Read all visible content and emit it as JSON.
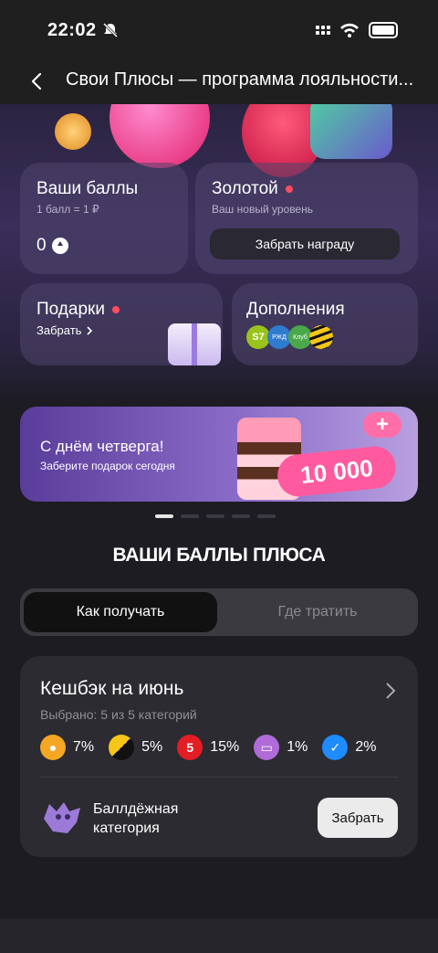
{
  "status_bar": {
    "time": "22:02"
  },
  "header": {
    "title": "Свои Плюсы — программа лояльности..."
  },
  "cards": {
    "points": {
      "title": "Ваши баллы",
      "subtitle": "1 балл = 1 ₽",
      "value": "0"
    },
    "level": {
      "title": "Золотой",
      "subtitle": "Ваш новый уровень",
      "button": "Забрать награду"
    },
    "gifts": {
      "title": "Подарки",
      "action": "Забрать"
    },
    "extras": {
      "title": "Дополнения",
      "partners": [
        "S7",
        "РЖД",
        "Клуб",
        "Билайн"
      ]
    }
  },
  "banner": {
    "title": "С днём четверга!",
    "subtitle": "Заберите подарок сегодня",
    "amount": "10 000"
  },
  "carousel": {
    "pages": 5,
    "active": 0
  },
  "section_title": "ВАШИ БАЛЛЫ ПЛЮСА",
  "tabs": [
    {
      "label": "Как получать",
      "active": true
    },
    {
      "label": "Где тратить",
      "active": false
    }
  ],
  "cashback": {
    "title": "Кешбэк на июнь",
    "subtitle": "Выбрано: 5 из 5 категорий",
    "categories": [
      {
        "icon": "apple-icon",
        "pct": "7%",
        "color": "#f5a623"
      },
      {
        "icon": "taxi-icon",
        "pct": "5%",
        "color": "#f5c518"
      },
      {
        "icon": "pyaterochka-icon",
        "pct": "15%",
        "color": "#e31e24"
      },
      {
        "icon": "ticket-icon",
        "pct": "1%",
        "color": "#b06bd8"
      },
      {
        "icon": "bird-icon",
        "pct": "2%",
        "color": "#1e8cff"
      }
    ],
    "special": {
      "label_line1": "Баллдёжная",
      "label_line2": "категория",
      "button": "Забрать"
    }
  }
}
